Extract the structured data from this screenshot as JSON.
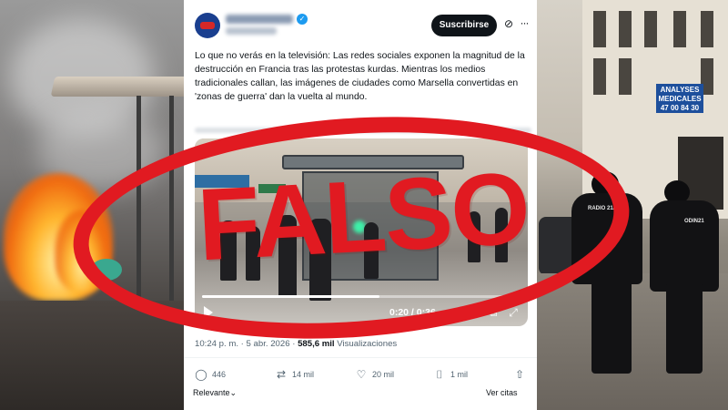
{
  "background": {
    "pharmacy_sign": "ANALYSES MEDICALES 47 00 84 30",
    "officer_tag_1": "RADIO 21/1",
    "officer_tag_2": "ODIN21"
  },
  "tweet": {
    "account_name": "News Day Mundo",
    "account_handle": "@NewsDayMundo",
    "subscribe_label": "Suscribirse",
    "more_label": "···",
    "text": "Lo que no verás en la televisión: Las redes sociales exponen la magnitud de la destrucción en Francia tras las protestas kurdas. Mientras los medios tradicionales callan, las imágenes de ciudades como Marsella convertidas en 'zonas de guerra' dan la vuelta al mundo.",
    "video": {
      "time": "0:20 / 0:36",
      "progress": 0.556
    },
    "timestamp": "10:24 p. m. · 5 abr. 2026 · ",
    "views_count": "585,6 mil",
    "views_label": " Visualizaciones",
    "actions": {
      "replies": "446",
      "reposts": "14 mil",
      "likes": "20 mil",
      "bookmarks": "1 mil"
    },
    "relevant_label": "Relevante",
    "see_quotes_label": "Ver citas"
  },
  "stamp": {
    "text": "FALSO",
    "color": "#e11a21"
  },
  "colors": {
    "accent_blue": "#1d9bf0",
    "text_primary": "#0f1419",
    "text_secondary": "#536471"
  }
}
